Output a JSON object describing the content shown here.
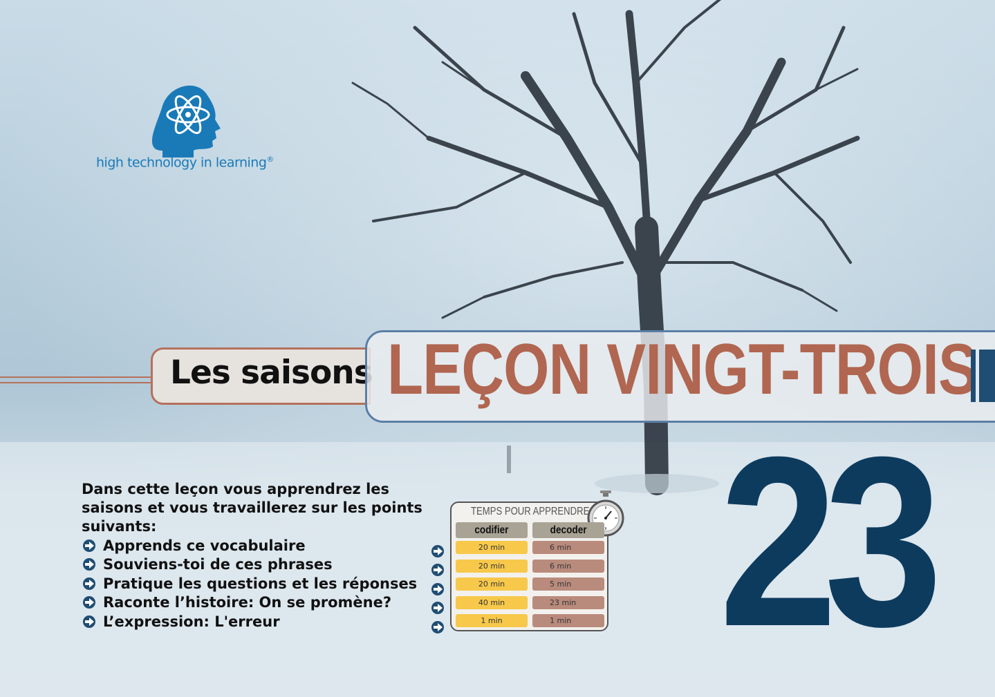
{
  "logo": {
    "text": "high technology in learning",
    "registered": "®",
    "icon": "atom-head-icon"
  },
  "subtitle": "Les saisons",
  "lesson_title": "LEÇON VINGT-TROIS",
  "lesson_number": "23",
  "intro": "Dans cette leçon vous apprendrez les saisons et vous travaillerez sur les points suivants:",
  "items": [
    "Apprends ce vocabulaire",
    "Souviens-toi de ces phrases",
    "Pratique les questions et les réponses",
    "Raconte l’histoire: On se promène?",
    "L’expression: L'erreur"
  ],
  "time_table": {
    "title": "TEMPS POUR APPRENDRE",
    "headers": [
      "codifier",
      "decoder"
    ],
    "rows": [
      [
        "20 min",
        "6 min"
      ],
      [
        "20 min",
        "6 min"
      ],
      [
        "20 min",
        "5 min"
      ],
      [
        "40 min",
        "23 min"
      ],
      [
        "1 min",
        "1 min"
      ]
    ]
  },
  "colors": {
    "accent": "#b06650",
    "navy": "#0d3b5e",
    "logo_blue": "#1a7ab8",
    "cell_yellow": "#f7c84a",
    "cell_brown": "#b98b7d"
  }
}
